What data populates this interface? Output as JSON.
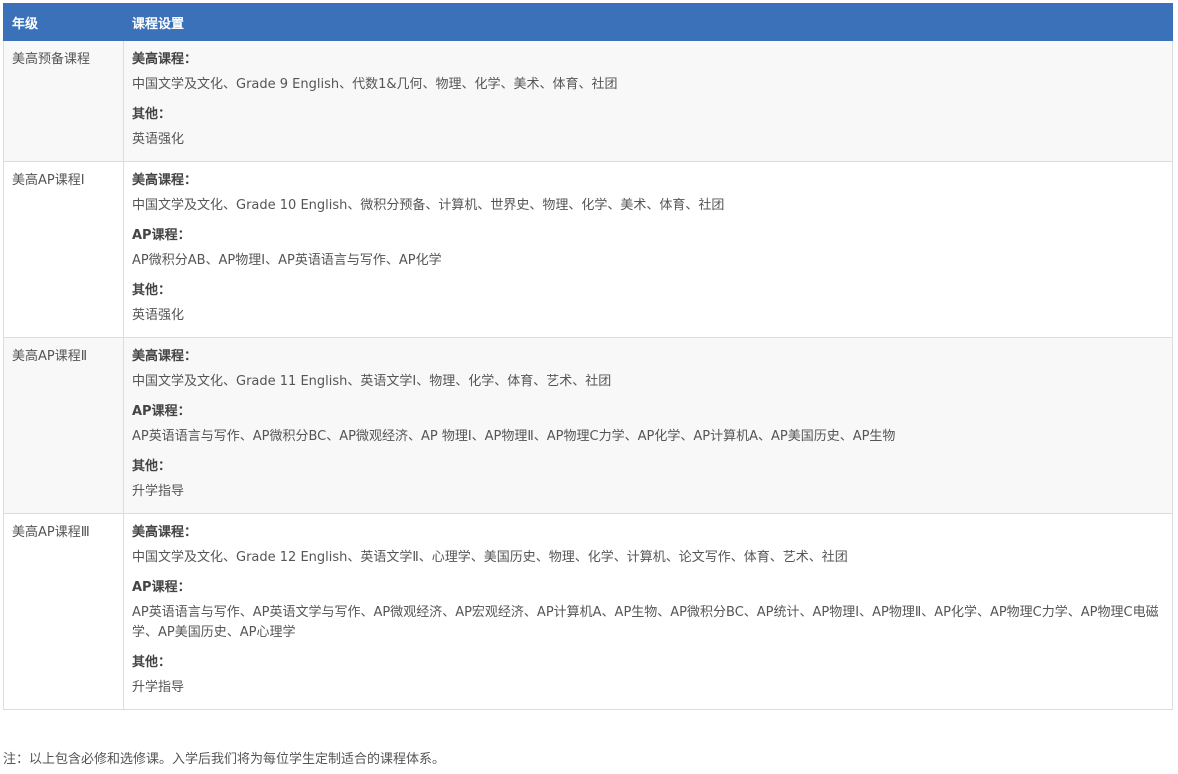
{
  "header": {
    "grade": "年级",
    "curriculum": "课程设置"
  },
  "rows": [
    {
      "grade": "美高预备课程",
      "groups": [
        {
          "heading": "美高课程：",
          "items": "中国文学及文化、Grade 9 English、代数1&几何、物理、化学、美术、体育、社团"
        },
        {
          "heading": "其他：",
          "items": "英语强化"
        }
      ]
    },
    {
      "grade": "美高AP课程Ⅰ",
      "groups": [
        {
          "heading": "美高课程：",
          "items": "中国文学及文化、Grade 10 English、微积分预备、计算机、世界史、物理、化学、美术、体育、社团"
        },
        {
          "heading": "AP课程：",
          "items": "AP微积分AB、AP物理Ⅰ、AP英语语言与写作、AP化学"
        },
        {
          "heading": "其他：",
          "items": "英语强化"
        }
      ]
    },
    {
      "grade": "美高AP课程Ⅱ",
      "groups": [
        {
          "heading": "美高课程：",
          "items": "中国文学及文化、Grade 11 English、英语文学Ⅰ、物理、化学、体育、艺术、社团"
        },
        {
          "heading": "AP课程：",
          "items": "AP英语语言与写作、AP微积分BC、AP微观经济、AP 物理Ⅰ、AP物理Ⅱ、AP物理C力学、AP化学、AP计算机A、AP美国历史、AP生物"
        },
        {
          "heading": "其他：",
          "items": "升学指导"
        }
      ]
    },
    {
      "grade": "美高AP课程Ⅲ",
      "groups": [
        {
          "heading": "美高课程：",
          "items": "中国文学及文化、Grade 12 English、英语文学Ⅱ、心理学、美国历史、物理、化学、计算机、论文写作、体育、艺术、社团"
        },
        {
          "heading": "AP课程：",
          "items": "AP英语语言与写作、AP英语文学与写作、AP微观经济、AP宏观经济、AP计算机A、AP生物、AP微积分BC、AP统计、AP物理Ⅰ、AP物理Ⅱ、AP化学、AP物理C力学、AP物理C电磁学、AP美国历史、AP心理学"
        },
        {
          "heading": "其他：",
          "items": "升学指导"
        }
      ]
    }
  ],
  "note": "注：以上包含必修和选修课。入学后我们将为每位学生定制适合的课程体系。"
}
